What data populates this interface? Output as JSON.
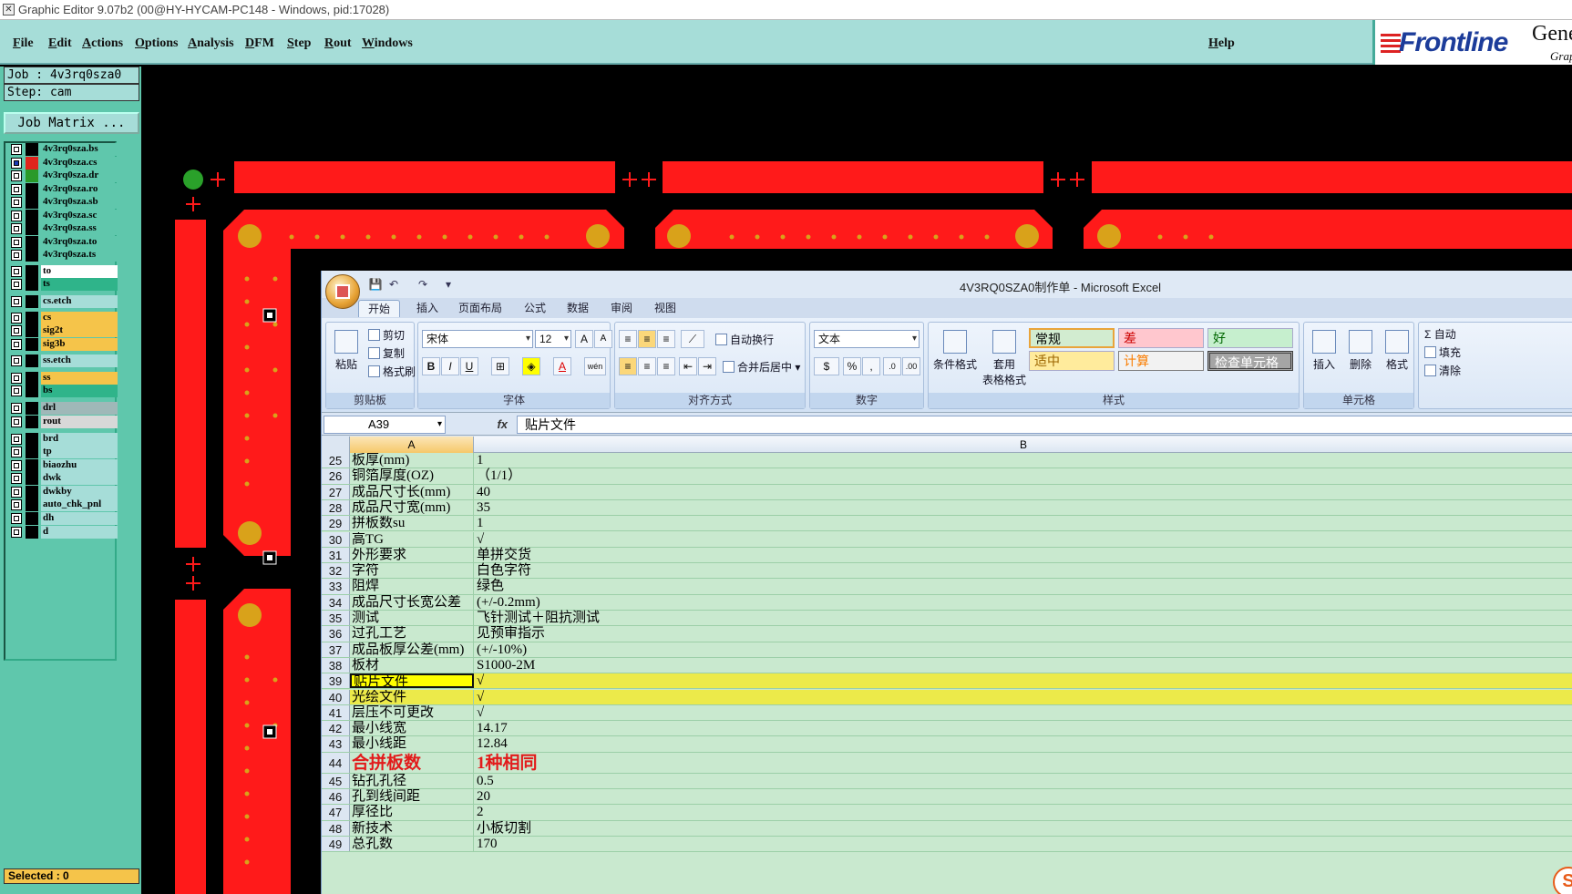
{
  "window": {
    "title": "Graphic Editor 9.07b2 (00@HY-HYCAM-PC148 - Windows, pid:17028)"
  },
  "menu": {
    "items": [
      "File",
      "Edit",
      "Actions",
      "Options",
      "Analysis",
      "DFM",
      "Step",
      "Rout",
      "Windows"
    ],
    "help": "Help"
  },
  "brand": {
    "logo": "Frontline",
    "product": "Gene",
    "sub": "Grap"
  },
  "job": {
    "job": "Job : 4v3rq0sza0",
    "step": "Step: cam",
    "matrix_button": "Job Matrix ..."
  },
  "layers": [
    {
      "name": "4v3rq0sza.bs",
      "color": "#000000",
      "bg": "#5fc7ac",
      "checked": false
    },
    {
      "name": "4v3rq0sza.cs",
      "color": "#e0241c",
      "bg": "#5fc7ac",
      "checked": true
    },
    {
      "name": "4v3rq0sza.dr",
      "color": "#2a9a2a",
      "bg": "#5fc7ac",
      "checked": false
    },
    {
      "name": "4v3rq0sza.ro",
      "color": "#000000",
      "bg": "#5fc7ac",
      "checked": false
    },
    {
      "name": "4v3rq0sza.sb",
      "color": "#000000",
      "bg": "#5fc7ac",
      "checked": false
    },
    {
      "name": "4v3rq0sza.sc",
      "color": "#000000",
      "bg": "#5fc7ac",
      "checked": false
    },
    {
      "name": "4v3rq0sza.ss",
      "color": "#000000",
      "bg": "#5fc7ac",
      "checked": false
    },
    {
      "name": "4v3rq0sza.to",
      "color": "#000000",
      "bg": "#5fc7ac",
      "checked": false
    },
    {
      "name": "4v3rq0sza.ts",
      "color": "#000000",
      "bg": "#5fc7ac",
      "checked": false
    },
    {
      "name": "to",
      "color": "#000000",
      "bg": "#ffffff",
      "checked": false
    },
    {
      "name": "ts",
      "color": "#000000",
      "bg": "#2fb48a",
      "checked": false
    },
    {
      "name": "cs.etch",
      "color": "#000000",
      "bg": "#a6ddd8",
      "checked": false
    },
    {
      "name": "cs",
      "color": "#000000",
      "bg": "#f5c44a",
      "checked": false
    },
    {
      "name": "sig2t",
      "color": "#000000",
      "bg": "#f5c44a",
      "checked": false
    },
    {
      "name": "sig3b",
      "color": "#000000",
      "bg": "#f5c44a",
      "checked": false
    },
    {
      "name": "ss.etch",
      "color": "#000000",
      "bg": "#a6ddd8",
      "checked": false
    },
    {
      "name": "ss",
      "color": "#000000",
      "bg": "#f5c44a",
      "checked": false
    },
    {
      "name": "bs",
      "color": "#000000",
      "bg": "#2fb48a",
      "checked": false
    },
    {
      "name": "drl",
      "color": "#000000",
      "bg": "#9fb8b8",
      "checked": false
    },
    {
      "name": "rout",
      "color": "#000000",
      "bg": "#d8d8d8",
      "checked": false
    },
    {
      "name": "brd",
      "color": "#000000",
      "bg": "#a6ddd8",
      "checked": false
    },
    {
      "name": "tp",
      "color": "#000000",
      "bg": "#a6ddd8",
      "checked": false
    },
    {
      "name": "biaozhu",
      "color": "#000000",
      "bg": "#a6ddd8",
      "checked": false
    },
    {
      "name": "dwk",
      "color": "#000000",
      "bg": "#a6ddd8",
      "checked": false
    },
    {
      "name": "dwkby",
      "color": "#000000",
      "bg": "#a6ddd8",
      "checked": false
    },
    {
      "name": "auto_chk_pnl",
      "color": "#000000",
      "bg": "#a6ddd8",
      "checked": false
    },
    {
      "name": "dh",
      "color": "#000000",
      "bg": "#a6ddd8",
      "checked": false
    },
    {
      "name": "d",
      "color": "#000000",
      "bg": "#a6ddd8",
      "checked": false
    }
  ],
  "status": {
    "selected": "Selected : 0"
  },
  "excel": {
    "title": "4V3RQ0SZA0制作单 - Microsoft Excel",
    "tabs": [
      "开始",
      "插入",
      "页面布局",
      "公式",
      "数据",
      "审阅",
      "视图"
    ],
    "clipboard": {
      "paste": "粘贴",
      "cut": "剪切",
      "copy": "复制",
      "format_painter": "格式刷",
      "label": "剪贴板"
    },
    "font": {
      "name": "宋体",
      "size": "12",
      "label": "字体"
    },
    "alignment": {
      "wrap": "自动换行",
      "merge": "合并后居中",
      "label": "对齐方式"
    },
    "number": {
      "format": "文本",
      "label": "数字"
    },
    "styles": {
      "cond_format": "条件格式",
      "table_format_1": "套用",
      "table_format_2": "表格格式",
      "normal": "常规",
      "bad": "差",
      "good": "好",
      "neutral": "适中",
      "calc": "计算",
      "check": "检查单元格",
      "label": "样式"
    },
    "cells": {
      "insert": "插入",
      "delete": "删除",
      "format": "格式",
      "label": "单元格"
    },
    "editing": {
      "autosum": "自动",
      "fill": "填充",
      "clear": "清除"
    },
    "namebox": "A39",
    "formula": "贴片文件",
    "col_a": "A",
    "col_b": "B",
    "rows": [
      {
        "n": "25",
        "a": "板厚(mm)",
        "b": "1"
      },
      {
        "n": "26",
        "a": "铜箔厚度(OZ)",
        "b": "（1/1）"
      },
      {
        "n": "27",
        "a": "成品尺寸长(mm)",
        "b": "40"
      },
      {
        "n": "28",
        "a": "成品尺寸宽(mm)",
        "b": "35"
      },
      {
        "n": "29",
        "a": "拼板数su",
        "b": "1"
      },
      {
        "n": "30",
        "a": "高TG",
        "b": "√"
      },
      {
        "n": "31",
        "a": "外形要求",
        "b": "单拼交货"
      },
      {
        "n": "32",
        "a": "字符",
        "b": "白色字符"
      },
      {
        "n": "33",
        "a": "阻焊",
        "b": "绿色"
      },
      {
        "n": "34",
        "a": "成品尺寸长宽公差",
        "b": "(+/-0.2mm)"
      },
      {
        "n": "35",
        "a": "测试",
        "b": "飞针测试＋阻抗测试"
      },
      {
        "n": "36",
        "a": "过孔工艺",
        "b": "见预审指示"
      },
      {
        "n": "37",
        "a": "成品板厚公差(mm)",
        "b": "(+/-10%)"
      },
      {
        "n": "38",
        "a": "板材",
        "b": "S1000-2M"
      },
      {
        "n": "39",
        "a": "贴片文件",
        "b": "√"
      },
      {
        "n": "40",
        "a": "光绘文件",
        "b": "√"
      },
      {
        "n": "41",
        "a": "层压不可更改",
        "b": "√"
      },
      {
        "n": "42",
        "a": "最小线宽",
        "b": "14.17"
      },
      {
        "n": "43",
        "a": "最小线距",
        "b": "12.84"
      },
      {
        "n": "44",
        "a": "合拼板数",
        "b": "1种相同"
      },
      {
        "n": "45",
        "a": "钻孔孔径",
        "b": "0.5"
      },
      {
        "n": "46",
        "a": "孔到线间距",
        "b": "20"
      },
      {
        "n": "47",
        "a": "厚径比",
        "b": "2"
      },
      {
        "n": "48",
        "a": "新技术",
        "b": "小板切割"
      },
      {
        "n": "49",
        "a": "总孔数",
        "b": "170"
      }
    ]
  }
}
